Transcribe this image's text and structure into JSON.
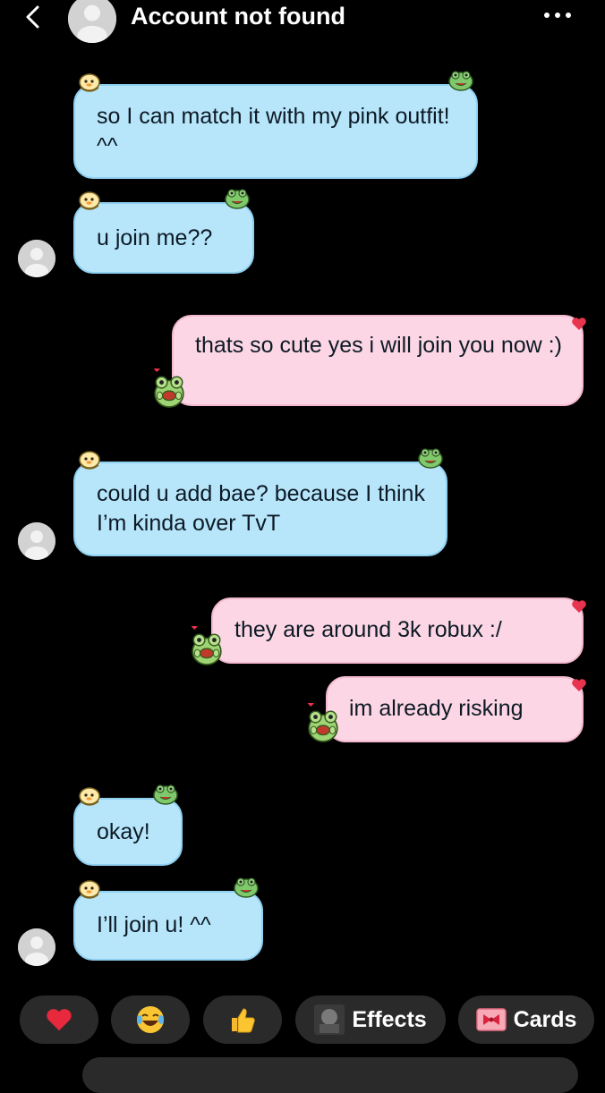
{
  "header": {
    "title": "Account not found"
  },
  "messages": [
    {
      "side": "received",
      "text": "so I can match it with my pink outfit! ^^"
    },
    {
      "side": "received",
      "text": "u join me??"
    },
    {
      "side": "sent",
      "text": "thats so cute yes i will join you now :)"
    },
    {
      "side": "received",
      "text": "could u add bae? because I think I’m kinda over TvT"
    },
    {
      "side": "sent",
      "text": "they are around 3k robux :/"
    },
    {
      "side": "sent",
      "text": "im already risking"
    },
    {
      "side": "received",
      "text": "okay!"
    },
    {
      "side": "received",
      "text": "I’ll join u! ^^"
    }
  ],
  "quick_actions": {
    "effects_label": "Effects",
    "cards_label": "Cards"
  },
  "icons": [
    "back-chevron-icon",
    "more-dots-icon",
    "heart-icon",
    "laughing-emoji-icon",
    "thumbs-up-icon",
    "effects-thumbnail-icon",
    "card-bow-icon",
    "frog-sticker-icon",
    "duck-sticker-icon"
  ],
  "colors": {
    "received_bubble": "#b7e6fb",
    "sent_bubble": "#fcd6e4",
    "background": "#000000",
    "chip": "#2a2a2a"
  }
}
